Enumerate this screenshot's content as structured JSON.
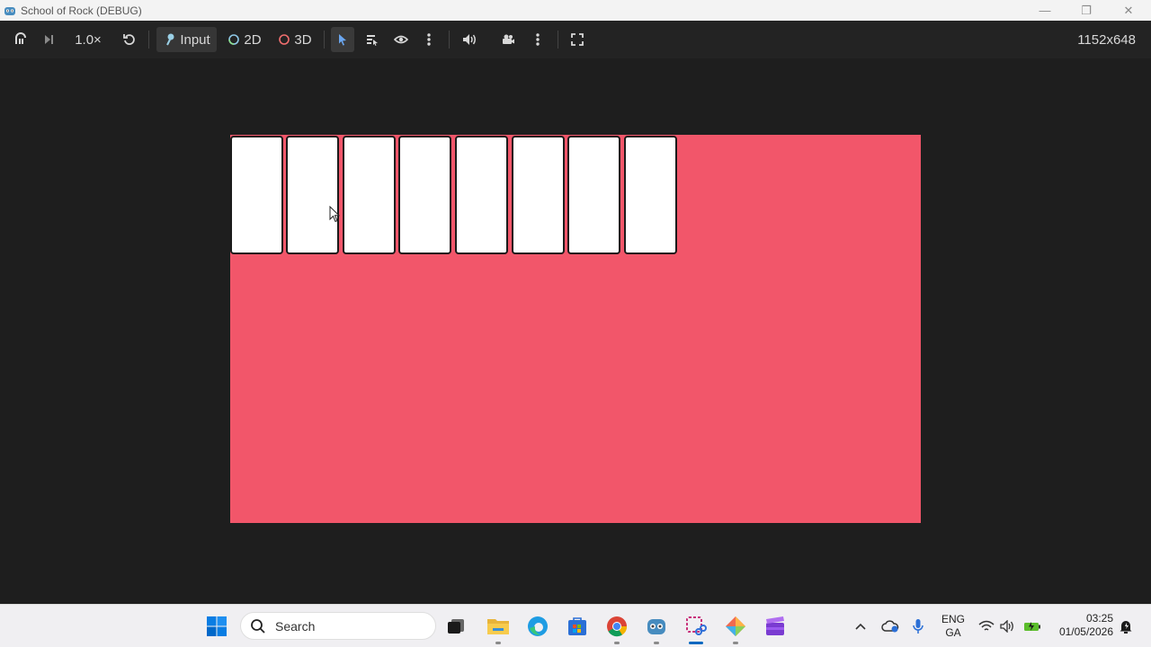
{
  "window": {
    "title": "School of Rock (DEBUG)",
    "minimize_glyph": "—",
    "restore_glyph": "❐",
    "close_glyph": "✕"
  },
  "toolbar": {
    "speed": "1.0×",
    "input_label": "Input",
    "label_2d": "2D",
    "label_3d": "3D",
    "resolution": "1152x648"
  },
  "game": {
    "background_color": "#f2566a",
    "card_color": "#ffffff",
    "card_count": 8
  },
  "taskbar": {
    "search_placeholder": "Search",
    "language_line1": "ENG",
    "language_line2": "GA",
    "time": "03:25",
    "date": "01/05/2026"
  }
}
